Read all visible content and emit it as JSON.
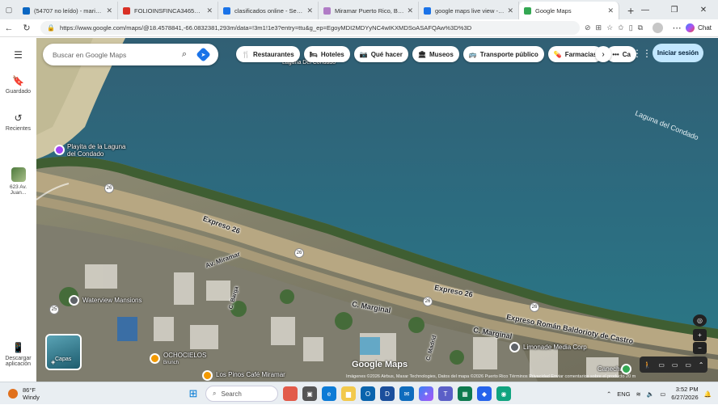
{
  "browser": {
    "tabs": [
      {
        "label": "(54707 no leído) - mariagon@",
        "color": "#0a66c2",
        "active": false
      },
      {
        "label": "FOLIOINSFINCA34650.pdf",
        "color": "#d93025",
        "active": false
      },
      {
        "label": "clasificados online - Search",
        "color": "#1a73e8",
        "active": false
      },
      {
        "label": "Miramar Puerto Rico, Bienes R",
        "color": "#b07cc6",
        "active": false
      },
      {
        "label": "google maps live view - Search",
        "color": "#1a73e8",
        "active": false
      },
      {
        "label": "Google Maps",
        "color": "#34a853",
        "active": true
      }
    ],
    "new_tab": "+",
    "url": "https://www.google.com/maps/@18.4578841,-66.0832381,293m/data=!3m1!1e3?entry=ttu&g_ep=EgoyMDI2MDYyNC4wIKXMDSoASAFQAw%3D%3D",
    "chat_label": "Chat"
  },
  "maps": {
    "search_placeholder": "Buscar en Google Maps",
    "chips": [
      {
        "label": "Restaurantes",
        "icon": "fork-knife-icon",
        "glyph": "🍴"
      },
      {
        "label": "Hoteles",
        "icon": "bed-icon",
        "glyph": "🛏"
      },
      {
        "label": "Qué hacer",
        "icon": "camera-icon",
        "glyph": "📷"
      },
      {
        "label": "Museos",
        "icon": "museum-icon",
        "glyph": "🏛"
      },
      {
        "label": "Transporte público",
        "icon": "bus-icon",
        "glyph": "🚌"
      },
      {
        "label": "Farmacias",
        "icon": "pharmacy-icon",
        "glyph": "💊"
      },
      {
        "label": "Ca",
        "icon": "more-icon",
        "glyph": "•••"
      }
    ],
    "sign_in": "Iniciar sesión",
    "rail": {
      "saved": "Guardado",
      "recents": "Recientes",
      "recent_place": "623 Av. Juan...",
      "download": "Descargar aplicación"
    },
    "layers_label": "Capas",
    "labels": {
      "laguna_top": "Laguna Del Condado",
      "laguna_right": "Laguna del Condado",
      "playita": "Playita de la Laguna del Condado",
      "expreso_26_a": "Expreso 26",
      "expreso_26_b": "Expreso 26",
      "av_miramar": "Av. Miramar",
      "c_marginal_a": "C. Marginal",
      "c_marginal_b": "C. Marginal",
      "expreso_roman": "Expreso Román Baldorioty de Castro",
      "waterview": "Waterview Mansions",
      "ochocielos": "OCHOCIELOS",
      "ochocielos_sub": "Brunch",
      "los_pinos": "Los Pinos Café Miramar",
      "limonade": "Limonade Media Corp",
      "canecha": "Canecha",
      "c_madrid": "C. Madrid",
      "c_barga": "C. Barga",
      "route_26": "26",
      "route_25": "25"
    },
    "logo": "Google Maps",
    "attribution": "Imágenes ©2026 Airbus, Maxar Technologies, Datos del mapa ©2026   Puerto Rico   Términos   Privacidad   Enviar comentarios sobre el producto   20 m"
  },
  "taskbar": {
    "weather_temp": "86°F",
    "weather_desc": "Windy",
    "search_placeholder": "Search",
    "lang": "ENG",
    "time": "3:52 PM",
    "date": "6/27/2026"
  }
}
